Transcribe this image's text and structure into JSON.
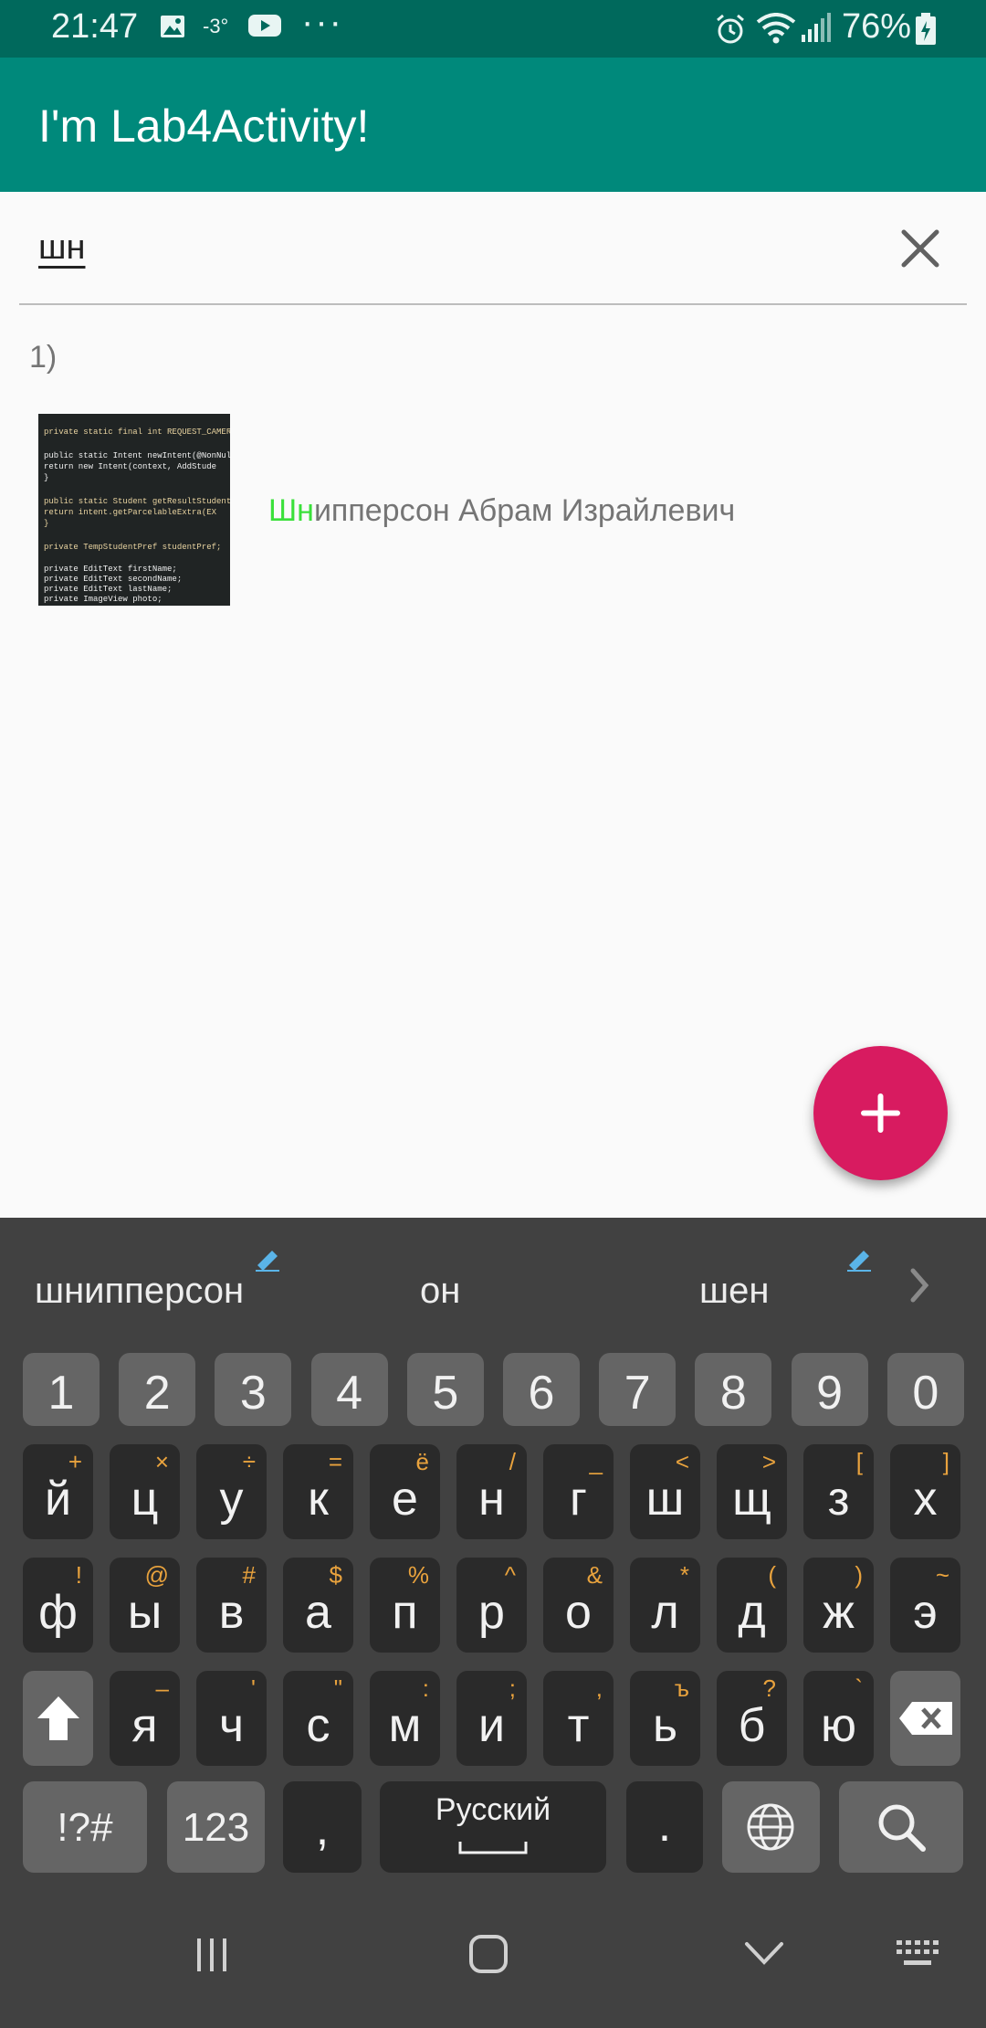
{
  "status_bar": {
    "time": "21:47",
    "temperature": "-3°",
    "battery": "76%",
    "icons": [
      "gallery-icon",
      "youtube-icon",
      "more-dots-icon",
      "alarm-icon",
      "wifi-icon",
      "signal-icon",
      "battery-charging-icon"
    ]
  },
  "app_bar": {
    "title": "I'm Lab4Activity!"
  },
  "search": {
    "query": "шн",
    "clear_icon": "close-icon"
  },
  "results": [
    {
      "index": "1)",
      "name_highlight": "Шн",
      "name_rest": "ипперсон Абрам Израйлевич",
      "photo_lines": [
        "private static final int REQUEST_CAMERA",
        "public static Intent newIntent(@NonNull",
        "    return new Intent(context, AddStude",
        "}",
        "public static Student getResultStudent(",
        "    return intent.getParcelableExtra(EX",
        "}",
        "private TempStudentPref studentPref;",
        "private EditText firstName;",
        "private EditText secondName;",
        "private EditText lastName;",
        "private ImageView photo;"
      ]
    }
  ],
  "fab": {
    "icon": "plus-icon"
  },
  "keyboard": {
    "suggestions": [
      "шнипперсон",
      "он",
      "шен"
    ],
    "number_row": [
      "1",
      "2",
      "3",
      "4",
      "5",
      "6",
      "7",
      "8",
      "9",
      "0"
    ],
    "row1": [
      {
        "k": "й",
        "h": "+"
      },
      {
        "k": "ц",
        "h": "×"
      },
      {
        "k": "у",
        "h": "÷"
      },
      {
        "k": "к",
        "h": "="
      },
      {
        "k": "е",
        "h": "ё"
      },
      {
        "k": "н",
        "h": "/"
      },
      {
        "k": "г",
        "h": "_"
      },
      {
        "k": "ш",
        "h": "<"
      },
      {
        "k": "щ",
        "h": ">"
      },
      {
        "k": "з",
        "h": "["
      },
      {
        "k": "х",
        "h": "]"
      }
    ],
    "row2": [
      {
        "k": "ф",
        "h": "!"
      },
      {
        "k": "ы",
        "h": "@"
      },
      {
        "k": "в",
        "h": "#"
      },
      {
        "k": "а",
        "h": "$"
      },
      {
        "k": "п",
        "h": "%"
      },
      {
        "k": "р",
        "h": "^"
      },
      {
        "k": "о",
        "h": "&"
      },
      {
        "k": "л",
        "h": "*"
      },
      {
        "k": "д",
        "h": "("
      },
      {
        "k": "ж",
        "h": ")"
      },
      {
        "k": "э",
        "h": "~"
      }
    ],
    "row3": [
      {
        "k": "я",
        "h": "–"
      },
      {
        "k": "ч",
        "h": "'"
      },
      {
        "k": "с",
        "h": "\""
      },
      {
        "k": "м",
        "h": ":"
      },
      {
        "k": "и",
        "h": ";"
      },
      {
        "k": "т",
        "h": ","
      },
      {
        "k": "ь",
        "h": "ъ"
      },
      {
        "k": "б",
        "h": "?"
      },
      {
        "k": "ю",
        "h": "`"
      }
    ],
    "symbols_label": "!?#",
    "numbers_label": "123",
    "comma_label": ",",
    "space_label": "Русский",
    "period_label": "."
  },
  "nav_bar": {
    "icons": [
      "recents-icon",
      "home-icon",
      "back-down-icon",
      "keyboard-icon"
    ]
  }
}
